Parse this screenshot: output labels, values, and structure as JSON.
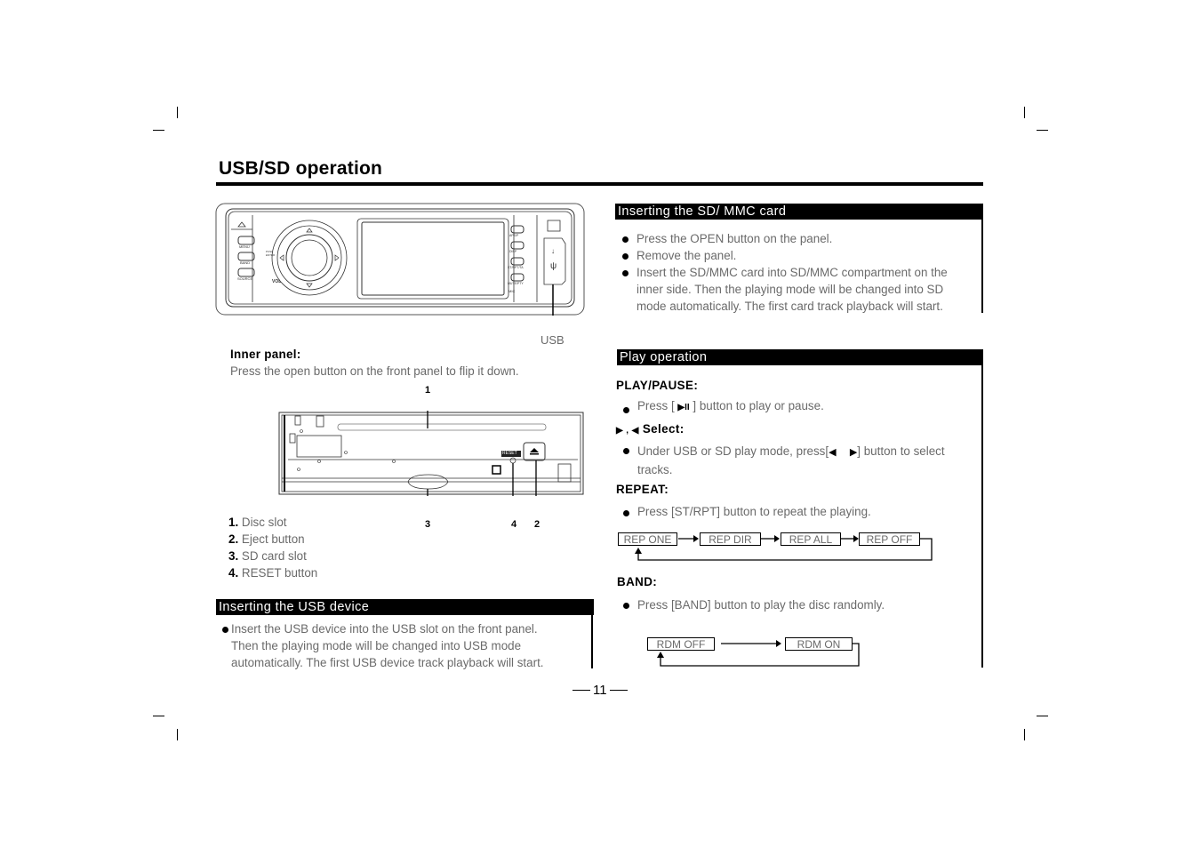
{
  "page": {
    "title": "USB/SD  operation",
    "page_number": "11"
  },
  "front_panel": {
    "buttons": [
      "MENU",
      "BAND",
      "SOURCE"
    ],
    "right_buttons": [
      "APS/P",
      "DISP",
      "ST/RPT/TA",
      "MUTE/PTY"
    ],
    "knob_labels": [
      "PUSH ENTER",
      "VOL"
    ],
    "mic_label": "MIC",
    "usb_callout": "USB"
  },
  "inner_panel": {
    "heading": "Inner panel:",
    "description": "Press the open button on the front panel to flip it down.",
    "reset_label": "RESET",
    "callouts": [
      "1",
      "2",
      "3",
      "4"
    ],
    "legend": [
      {
        "num": "1.",
        "text": "Disc slot"
      },
      {
        "num": "2.",
        "text": "Eject button"
      },
      {
        "num": "3.",
        "text": "SD card slot"
      },
      {
        "num": "4.",
        "text": "RESET button"
      }
    ]
  },
  "usb_section": {
    "heading": "Inserting the USB device",
    "lines": [
      "Insert the USB device into the USB slot on the front panel.",
      "Then the playing mode will be changed into USB mode",
      "automatically. The first USB device track playback will start."
    ]
  },
  "sd_section": {
    "heading": "Inserting the SD/ MMC card",
    "bullets": [
      [
        "Press the OPEN button on the panel."
      ],
      [
        "Remove the panel."
      ],
      [
        "Insert the SD/MMC card into SD/MMC compartment on the",
        "inner side. Then the playing mode will be changed into SD",
        "mode automatically. The first card track playback will start."
      ]
    ]
  },
  "play_section": {
    "heading": "Play operation",
    "play_pause": {
      "label": "PLAY/PAUSE:",
      "text_before": "Press [",
      "icon": "▶II",
      "text_after": "] button to play or pause."
    },
    "select": {
      "label_prefix": "▶ ,  ◀",
      "label": "Select:",
      "line1_before": "Under USB or SD play mode, press[",
      "line1_icons": "◀     ▶",
      "line1_after": "] button to select",
      "line2": "tracks."
    },
    "repeat": {
      "label": "REPEAT:",
      "text": "Press [ST/RPT] button  to repeat the playing.",
      "flow": [
        "REP ONE",
        "REP DIR",
        "REP ALL",
        "REP  OFF"
      ]
    },
    "band": {
      "label": "BAND:",
      "text": "Press [BAND] button to play the disc randomly.",
      "flow": [
        "RDM  OFF",
        "RDM ON"
      ]
    }
  }
}
